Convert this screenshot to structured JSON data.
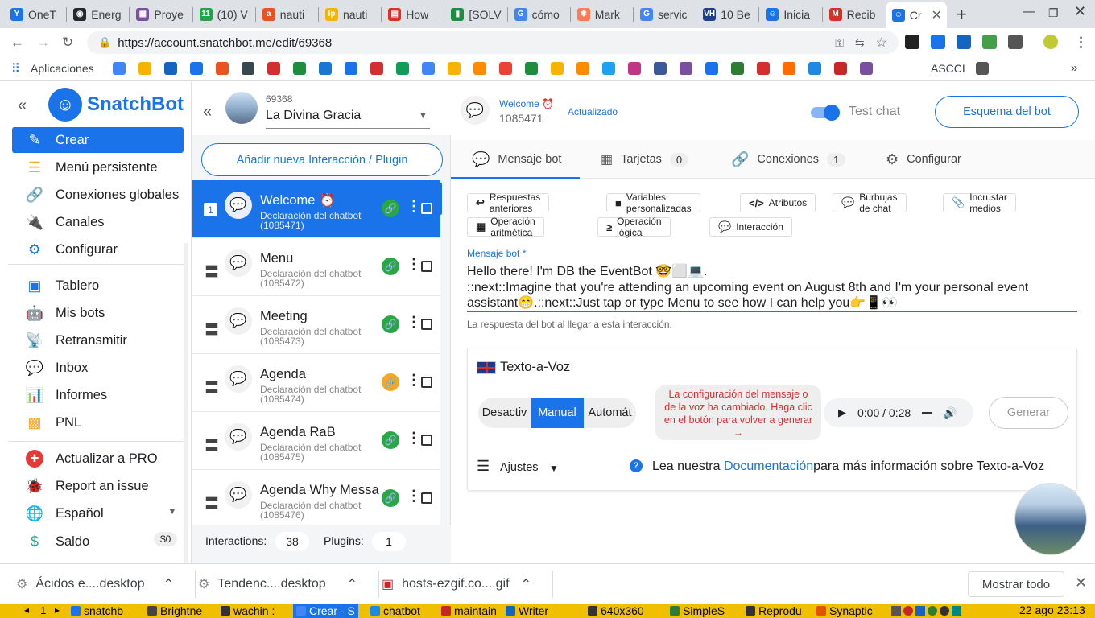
{
  "browser": {
    "tabs": [
      {
        "label": "OneT",
        "color": "#1a73e8",
        "glyph": "Y"
      },
      {
        "label": "Energ",
        "color": "#24292e",
        "glyph": "◉"
      },
      {
        "label": "Proye",
        "color": "#7b4fa0",
        "glyph": "▦"
      },
      {
        "label": "(10) V",
        "color": "#25a244",
        "glyph": "11"
      },
      {
        "label": "nauti",
        "color": "#e8531f",
        "glyph": "a"
      },
      {
        "label": "nauti",
        "color": "#f5b400",
        "glyph": "lp"
      },
      {
        "label": "How",
        "color": "#d93025",
        "glyph": "▤"
      },
      {
        "label": "[SOLV",
        "color": "#1e8e3e",
        "glyph": "▮"
      },
      {
        "label": "cómo",
        "color": "#4285f4",
        "glyph": "G"
      },
      {
        "label": "Mark",
        "color": "#ff7a59",
        "glyph": "✱"
      },
      {
        "label": "servic",
        "color": "#4285f4",
        "glyph": "G"
      },
      {
        "label": "10 Be",
        "color": "#1d3f8f",
        "glyph": "VH"
      },
      {
        "label": "Inicia",
        "color": "#1a73e8",
        "glyph": "☺"
      },
      {
        "label": "Recib",
        "color": "#d93025",
        "glyph": "M"
      },
      {
        "label": "Cr",
        "color": "#1a73e8",
        "glyph": "☺"
      }
    ],
    "url": "https://account.snatchbot.me/edit/69368",
    "bookmarks_label": "Aplicaciones",
    "bookmark_ascci": "ASCCI"
  },
  "sidebar": {
    "brand": "SnatchBot",
    "items": [
      {
        "label": "Crear",
        "icon": "pencil-icon",
        "color": "#fff"
      },
      {
        "label": "Menú persistente",
        "icon": "menu-lines-icon",
        "color": "#f5a623"
      },
      {
        "label": "Conexiones globales",
        "icon": "link-icon",
        "color": "#e84393"
      },
      {
        "label": "Canales",
        "icon": "plug-icon",
        "color": "#e53935"
      },
      {
        "label": "Configurar",
        "icon": "gear-icon",
        "color": "#1a73e8"
      },
      {
        "label": "Tablero",
        "icon": "dashboard-icon",
        "color": "#1a73e8"
      },
      {
        "label": "Mis bots",
        "icon": "robot-icon",
        "color": "#1a73e8"
      },
      {
        "label": "Retransmitir",
        "icon": "broadcast-icon",
        "color": "#e53935"
      },
      {
        "label": "Inbox",
        "icon": "chat-icon",
        "color": "#ff7043"
      },
      {
        "label": "Informes",
        "icon": "bar-chart-icon",
        "color": "#5c6bc0"
      },
      {
        "label": "PNL",
        "icon": "cubes-icon",
        "color": "#f5a623"
      },
      {
        "label": "Actualizar a PRO",
        "icon": "plus-circle-icon",
        "color": "#e53935"
      },
      {
        "label": "Report an issue",
        "icon": "bug-icon",
        "color": "#333"
      },
      {
        "label": "Español",
        "icon": "globe-icon",
        "color": "#29b6f6"
      },
      {
        "label": "Saldo",
        "icon": "dollar-icon",
        "color": "#26a69a"
      }
    ],
    "balance": "$0"
  },
  "bot": {
    "id": "69368",
    "name": "La Divina Gracia"
  },
  "list": {
    "add_button": "Añadir nueva Interacción / Plugin",
    "items": [
      {
        "title": "Welcome ⏰",
        "sub1": "Declaración del chatbot",
        "sub2": "(1085471)",
        "link_color": "#28a745",
        "num": "1"
      },
      {
        "title": "Menu",
        "sub1": "Declaración del chatbot",
        "sub2": "(1085472)",
        "link_color": "#28a745"
      },
      {
        "title": "Meeting",
        "sub1": "Declaración del chatbot",
        "sub2": "(1085473)",
        "link_color": "#28a745"
      },
      {
        "title": "Agenda",
        "sub1": "Declaración del chatbot",
        "sub2": "(1085474)",
        "link_color": "#f5a623"
      },
      {
        "title": "Agenda RaB",
        "sub1": "Declaración del chatbot",
        "sub2": "(1085475)",
        "link_color": "#28a745"
      },
      {
        "title": "Agenda Why Messa",
        "sub1": "Declaración del chatbot",
        "sub2": "(1085476)",
        "link_color": "#28a745"
      }
    ],
    "footer_interactions_label": "Interactions:",
    "footer_interactions": "38",
    "footer_plugins_label": "Plugins:",
    "footer_plugins": "1"
  },
  "main": {
    "interaction_name": "Welcome ⏰",
    "interaction_id": "1085471",
    "status": "Actualizado",
    "test_chat": "Test chat",
    "outline_button": "Esquema del bot",
    "tabs": [
      {
        "label": "Mensaje bot",
        "icon": "chat-icon"
      },
      {
        "label": "Tarjetas",
        "icon": "cards-icon",
        "badge": "0"
      },
      {
        "label": "Conexiones",
        "icon": "link-icon",
        "badge": "1"
      },
      {
        "label": "Configurar",
        "icon": "gear-icon"
      }
    ],
    "chips_row1": [
      {
        "label": "Respuestas anteriores",
        "icon": "reply-icon"
      },
      {
        "label": "Variables personalizadas",
        "icon": "variable-icon"
      },
      {
        "label": "Atributos",
        "icon": "code-icon"
      },
      {
        "label": "Burbujas de chat",
        "icon": "chat-icon"
      },
      {
        "label": "Incrustar medios",
        "icon": "paperclip-icon"
      }
    ],
    "chips_row2": [
      {
        "label": "Operación aritmética",
        "icon": "calculator-icon"
      },
      {
        "label": "Operación lógica",
        "icon": "greater-equal-icon"
      },
      {
        "label": "Interacción",
        "icon": "chat-icon"
      }
    ],
    "message_label": "Mensaje bot *",
    "message_line1": "Hello there! I'm DB the EventBot 🤓⬜💻.",
    "message_line2": "::next::Imagine that you're attending an upcoming event on August 8th and I'm your personal event",
    "message_line3": "assistant😁.::next::Just tap or type Menu to see how I can help you👉📱👀",
    "message_hint": "La respuesta del bot al llegar a esta interacción.",
    "tts": {
      "title": "Texto-a-Voz",
      "modes": [
        "Desactiv",
        "Manual",
        "Automát"
      ],
      "warning": "La configuración del mensaje o de la voz ha cambiado. Haga clic en el botón para volver a generar →",
      "time": "0:00 / 0:28",
      "generate": "Generar",
      "settings": "Ajustes",
      "doc_prefix": "Lea nuestra ",
      "doc_link": "Documentación",
      "doc_suffix": "para más información sobre Texto-a-Voz"
    }
  },
  "downloads": [
    {
      "label": "Ácidos e....desktop"
    },
    {
      "label": "Tendenc....desktop"
    },
    {
      "label": "hosts-ezgif.co....gif"
    }
  ],
  "show_all": "Mostrar todo",
  "panel": {
    "items": [
      "snatchb",
      "Brightne",
      "wachin :",
      "Crear - S",
      "chatbot",
      "maintain",
      "Writer",
      "640x360",
      "SimpleS",
      "Reprodu",
      "Synaptic"
    ],
    "workspace": "1",
    "clock": "22 ago 23:13"
  }
}
